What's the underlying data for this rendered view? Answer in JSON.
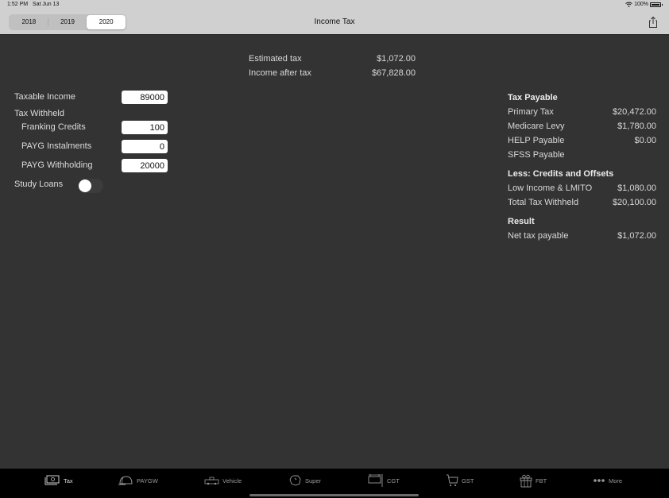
{
  "status_bar": {
    "time": "1:52 PM",
    "date": "Sat Jun 13",
    "battery": "100%",
    "wifi_icon": "wifi-icon",
    "battery_icon": "battery-icon"
  },
  "nav": {
    "title": "Income Tax",
    "years": [
      "2018",
      "2019",
      "2020"
    ],
    "selected_year": "2020",
    "share_icon": "share-icon"
  },
  "summary": {
    "rows": [
      {
        "label": "Estimated tax",
        "value": "$1,072.00"
      },
      {
        "label": "Income after tax",
        "value": "$67,828.00"
      }
    ]
  },
  "inputs": {
    "taxable_income": {
      "label": "Taxable Income",
      "value": "89000"
    },
    "tax_withheld_label": "Tax Withheld",
    "franking_credits": {
      "label": "Franking Credits",
      "value": "100"
    },
    "payg_instalments": {
      "label": "PAYG Instalments",
      "value": "0"
    },
    "payg_withholding": {
      "label": "PAYG Withholding",
      "value": "20000"
    },
    "study_loans": {
      "label": "Study Loans",
      "on": false
    }
  },
  "breakdown": {
    "tax_payable": {
      "header": "Tax Payable",
      "rows": [
        {
          "label": "Primary Tax",
          "value": "$20,472.00"
        },
        {
          "label": "Medicare Levy",
          "value": "$1,780.00"
        },
        {
          "label": "HELP Payable",
          "value": "$0.00"
        },
        {
          "label": "SFSS Payable",
          "value": ""
        }
      ]
    },
    "credits": {
      "header": "Less: Credits and Offsets",
      "rows": [
        {
          "label": "Low Income & LMITO",
          "value": "$1,080.00"
        },
        {
          "label": "Total Tax Withheld",
          "value": "$20,100.00"
        }
      ]
    },
    "result": {
      "header": "Result",
      "rows": [
        {
          "label": "Net tax payable",
          "value": "$1,072.00"
        }
      ]
    }
  },
  "tabs": [
    {
      "label": "Tax",
      "icon": "cash-icon",
      "active": true
    },
    {
      "label": "PAYGW",
      "icon": "hard-hat-icon",
      "active": false
    },
    {
      "label": "Vehicle",
      "icon": "car-icon",
      "active": false
    },
    {
      "label": "Super",
      "icon": "piggy-bank-icon",
      "active": false
    },
    {
      "label": "CGT",
      "icon": "sign-icon",
      "active": false
    },
    {
      "label": "GST",
      "icon": "cart-icon",
      "active": false
    },
    {
      "label": "FBT",
      "icon": "gift-icon",
      "active": false
    },
    {
      "label": "More",
      "icon": "more-icon",
      "active": false
    }
  ],
  "colors": {
    "background": "#333333",
    "nav_background": "#d0d0d0",
    "tab_bar_background": "#000000"
  }
}
